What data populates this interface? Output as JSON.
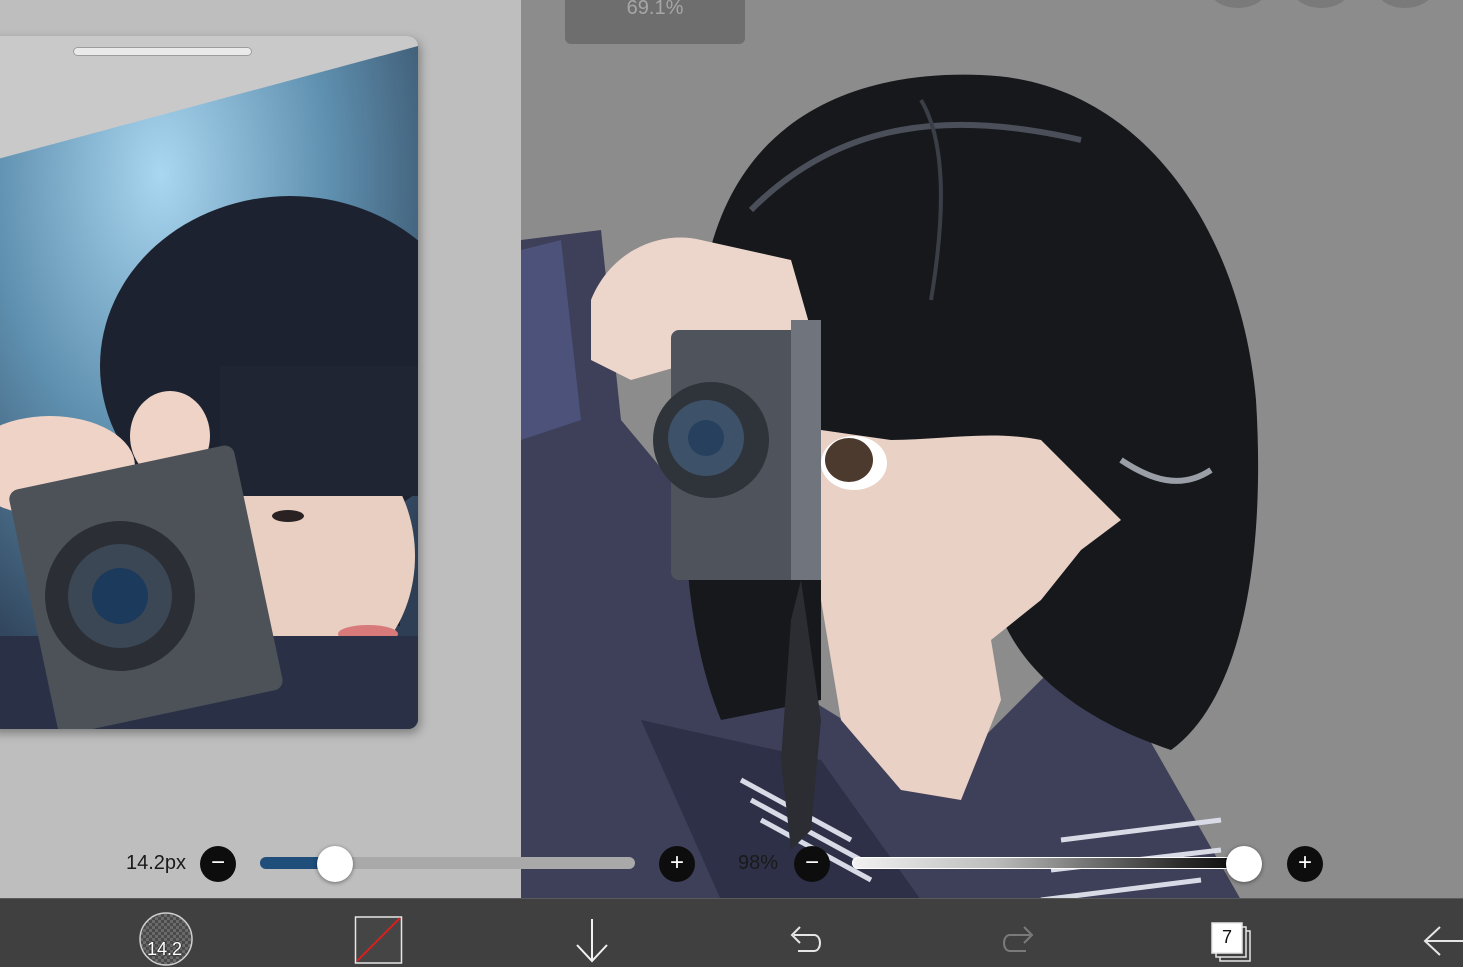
{
  "reference": {
    "handle_icon": "drag-handle"
  },
  "canvas": {
    "zoom_label": "69.1%"
  },
  "brush_size": {
    "value_label": "14.2px",
    "minus_label": "−",
    "plus_label": "+",
    "level": 0.2
  },
  "opacity": {
    "value_label": "98%",
    "minus_label": "−",
    "plus_label": "+",
    "level": 0.98
  },
  "toolbar": {
    "brush_badge_label": "14.2",
    "layer_count": "7",
    "icons": {
      "brush": "brush-size-icon",
      "color": "color-swatch-icon",
      "download": "arrow-down-icon",
      "undo": "undo-icon",
      "redo": "redo-icon",
      "layers": "layers-icon",
      "back": "arrow-left-icon"
    }
  },
  "colors": {
    "accent": "#1f4e7a",
    "toolbar_bg": "#404040",
    "canvas_bg": "#8c8c8c",
    "panel_bg": "#bebebe"
  }
}
